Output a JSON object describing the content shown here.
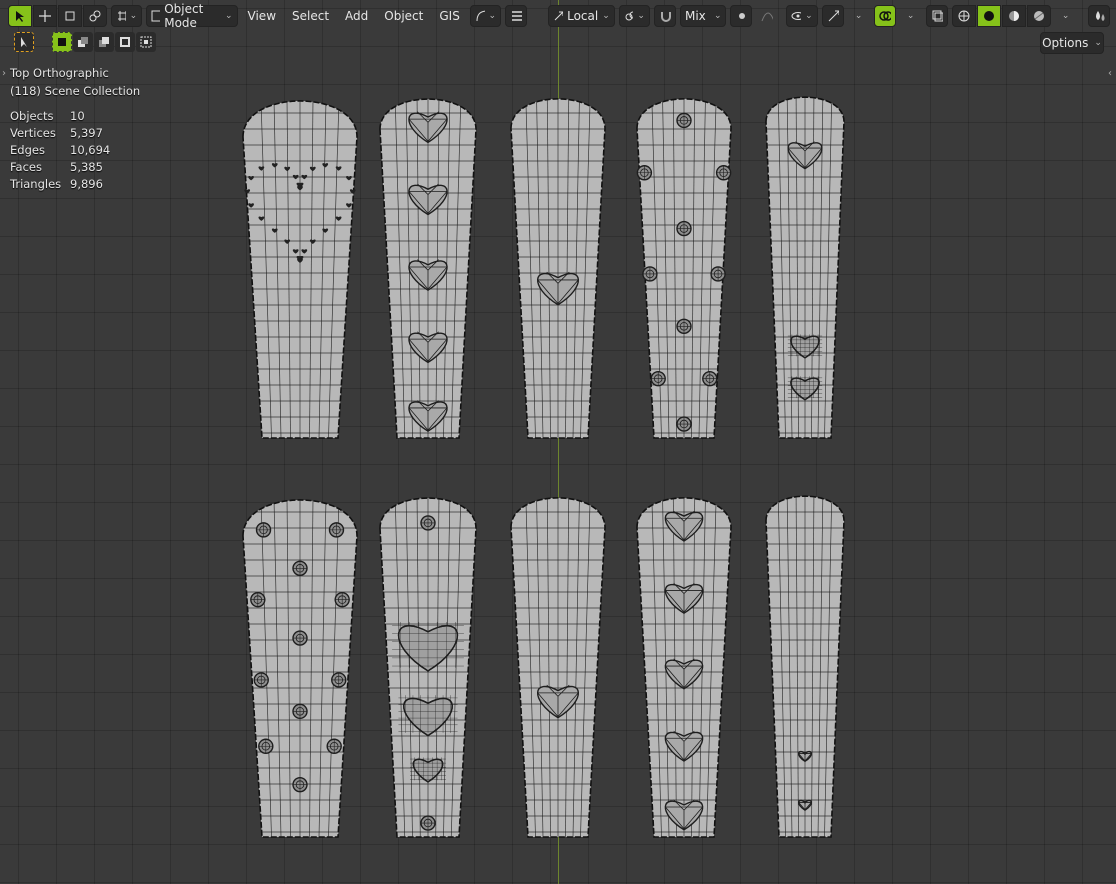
{
  "header": {
    "mode_label": "Object Mode",
    "menus": [
      "View",
      "Select",
      "Add",
      "Object",
      "GIS"
    ],
    "transform_pivot": "Local",
    "snap_mode": "Mix",
    "options_label": "Options"
  },
  "overlay": {
    "view_name": "Top Orthographic",
    "collection": "(118) Scene Collection",
    "stats": [
      {
        "label": "Objects",
        "value": "10"
      },
      {
        "label": "Vertices",
        "value": "5,397"
      },
      {
        "label": "Edges",
        "value": "10,694"
      },
      {
        "label": "Faces",
        "value": "5,385"
      },
      {
        "label": "Triangles",
        "value": "9,896"
      }
    ]
  },
  "colors": {
    "accent": "#86c21a",
    "background": "#3a3a3a",
    "mesh": "#b8b8b8",
    "wire": "#1e1e1e"
  },
  "nails": [
    {
      "row": 0,
      "col": 0,
      "decoration": "heart-outline-of-small-hearts"
    },
    {
      "row": 0,
      "col": 1,
      "decoration": "five-gem-hearts"
    },
    {
      "row": 0,
      "col": 2,
      "decoration": "one-gem-heart"
    },
    {
      "row": 0,
      "col": 3,
      "decoration": "studs"
    },
    {
      "row": 0,
      "col": 4,
      "decoration": "gem-heart-and-two-puffy-hearts"
    },
    {
      "row": 1,
      "col": 0,
      "decoration": "studs"
    },
    {
      "row": 1,
      "col": 1,
      "decoration": "puffy-hearts-and-studs"
    },
    {
      "row": 1,
      "col": 2,
      "decoration": "one-gem-heart"
    },
    {
      "row": 1,
      "col": 3,
      "decoration": "five-gem-hearts"
    },
    {
      "row": 1,
      "col": 4,
      "decoration": "two-small-hearts"
    }
  ]
}
